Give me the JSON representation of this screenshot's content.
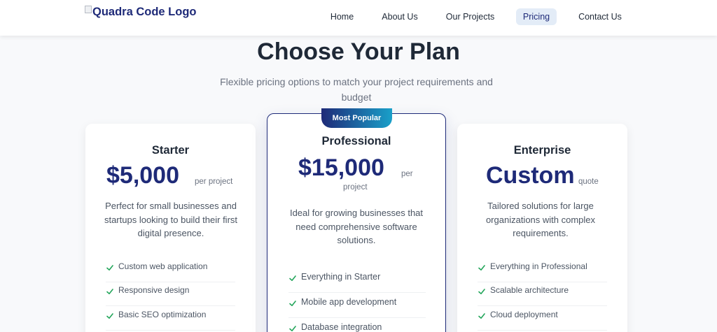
{
  "header": {
    "logo_alt": "Quadra Code Logo",
    "nav": [
      {
        "label": "Home",
        "active": false
      },
      {
        "label": "About Us",
        "active": false
      },
      {
        "label": "Our Projects",
        "active": false
      },
      {
        "label": "Pricing",
        "active": true
      },
      {
        "label": "Contact Us",
        "active": false
      }
    ]
  },
  "section": {
    "title": "Choose Your Plan",
    "subtitle": "Flexible pricing options to match your project requirements and budget"
  },
  "plans": [
    {
      "name": "Starter",
      "price": "$5,000",
      "price_note": "per project",
      "description": "Perfect for small businesses and startups looking to build their first digital presence.",
      "features": [
        "Custom web application",
        "Responsive design",
        "Basic SEO optimization"
      ]
    },
    {
      "name": "Professional",
      "badge": "Most Popular",
      "price": "$15,000",
      "price_note_1": "per",
      "price_note_2": "project",
      "description": "Ideal for growing businesses that need comprehensive software solutions.",
      "features": [
        "Everything in Starter",
        "Mobile app development",
        "Database integration"
      ]
    },
    {
      "name": "Enterprise",
      "price": "Custom",
      "price_note": "quote",
      "description": "Tailored solutions for large organizations with complex requirements.",
      "features": [
        "Everything in Professional",
        "Scalable architecture",
        "Cloud deployment"
      ]
    }
  ],
  "colors": {
    "accent": "#1e2a78",
    "check": "#22a55a",
    "badge_gradient_end": "#1aa0c9"
  }
}
